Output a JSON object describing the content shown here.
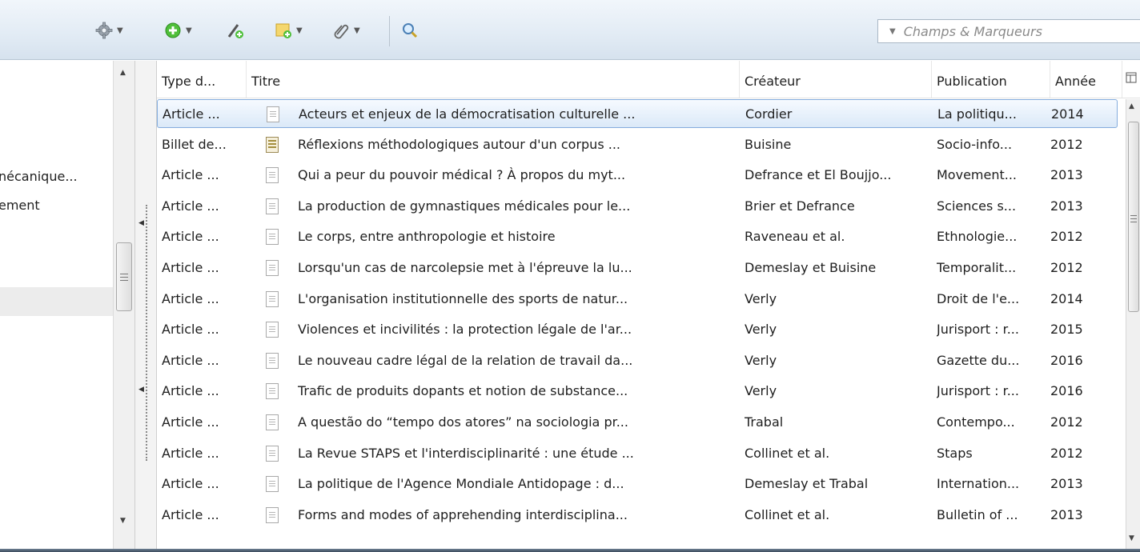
{
  "toolbar": {
    "search": {
      "placeholder": "Champs & Marqueurs",
      "drop_glyph": "▼"
    },
    "drop_glyph": "▼"
  },
  "left_pane": {
    "items": [
      {
        "label": "nécanique..."
      },
      {
        "label": "ement"
      }
    ]
  },
  "table": {
    "columns": [
      {
        "label": "Type d..."
      },
      {
        "label": "Titre"
      },
      {
        "label": "Créateur"
      },
      {
        "label": "Publication"
      },
      {
        "label": "Année"
      }
    ],
    "rows": [
      {
        "type": "Article ...",
        "icon": "document-icon",
        "title": "Acteurs et enjeux de la démocratisation culturelle ...",
        "creator": "Cordier",
        "publication": "La politiqu...",
        "year": "2014",
        "selected": true
      },
      {
        "type": "Billet de...",
        "icon": "blog-post-icon",
        "title": "Réflexions méthodologiques autour d'un corpus ...",
        "creator": "Buisine",
        "publication": "Socio-info...",
        "year": "2012"
      },
      {
        "type": "Article ...",
        "icon": "document-icon",
        "title": "Qui a peur du pouvoir médical ? À propos du myt...",
        "creator": "Defrance et El Boujjo...",
        "publication": "Movement...",
        "year": "2013"
      },
      {
        "type": "Article ...",
        "icon": "document-icon",
        "title": "La production de gymnastiques médicales pour le...",
        "creator": "Brier et Defrance",
        "publication": "Sciences s...",
        "year": "2013"
      },
      {
        "type": "Article ...",
        "icon": "document-icon",
        "title": "Le corps, entre anthropologie et histoire",
        "creator": "Raveneau et al.",
        "publication": "Ethnologie...",
        "year": "2012"
      },
      {
        "type": "Article ...",
        "icon": "document-icon",
        "title": "Lorsqu'un cas de narcolepsie met à l'épreuve la lu...",
        "creator": "Demeslay et Buisine",
        "publication": "Temporalit...",
        "year": "2012"
      },
      {
        "type": "Article ...",
        "icon": "document-icon",
        "title": "L'organisation institutionnelle des sports de natur...",
        "creator": "Verly",
        "publication": "Droit de l'e...",
        "year": "2014"
      },
      {
        "type": "Article ...",
        "icon": "document-icon",
        "title": "Violences et incivilités : la protection légale de l'ar...",
        "creator": "Verly",
        "publication": "Jurisport : r...",
        "year": "2015"
      },
      {
        "type": "Article ...",
        "icon": "document-icon",
        "title": "Le nouveau cadre légal de la relation de travail da...",
        "creator": "Verly",
        "publication": "Gazette du...",
        "year": "2016"
      },
      {
        "type": "Article ...",
        "icon": "document-icon",
        "title": "Trafic de produits dopants et notion de substance...",
        "creator": "Verly",
        "publication": "Jurisport : r...",
        "year": "2016"
      },
      {
        "type": "Article ...",
        "icon": "document-icon",
        "title": "A questão do “tempo dos atores” na sociologia pr...",
        "creator": "Trabal",
        "publication": "Contempo...",
        "year": "2012"
      },
      {
        "type": "Article ...",
        "icon": "document-icon",
        "title": "La Revue STAPS et l'interdisciplinarité : une étude ...",
        "creator": "Collinet et al.",
        "publication": "Staps",
        "year": "2012"
      },
      {
        "type": "Article ...",
        "icon": "document-icon",
        "title": "La politique de l'Agence Mondiale Antidopage : d...",
        "creator": "Demeslay et Trabal",
        "publication": "Internation...",
        "year": "2013"
      },
      {
        "type": "Article ...",
        "icon": "document-icon",
        "title": "Forms and modes of apprehending interdisciplina...",
        "creator": "Collinet et al.",
        "publication": "Bulletin of ...",
        "year": "2013"
      }
    ]
  },
  "colors": {
    "toolbar_top": "#f1f6fb",
    "toolbar_bottom": "#d6e2ee",
    "selection_border": "#84acdd",
    "selection_fill": "#dbe9f8"
  }
}
